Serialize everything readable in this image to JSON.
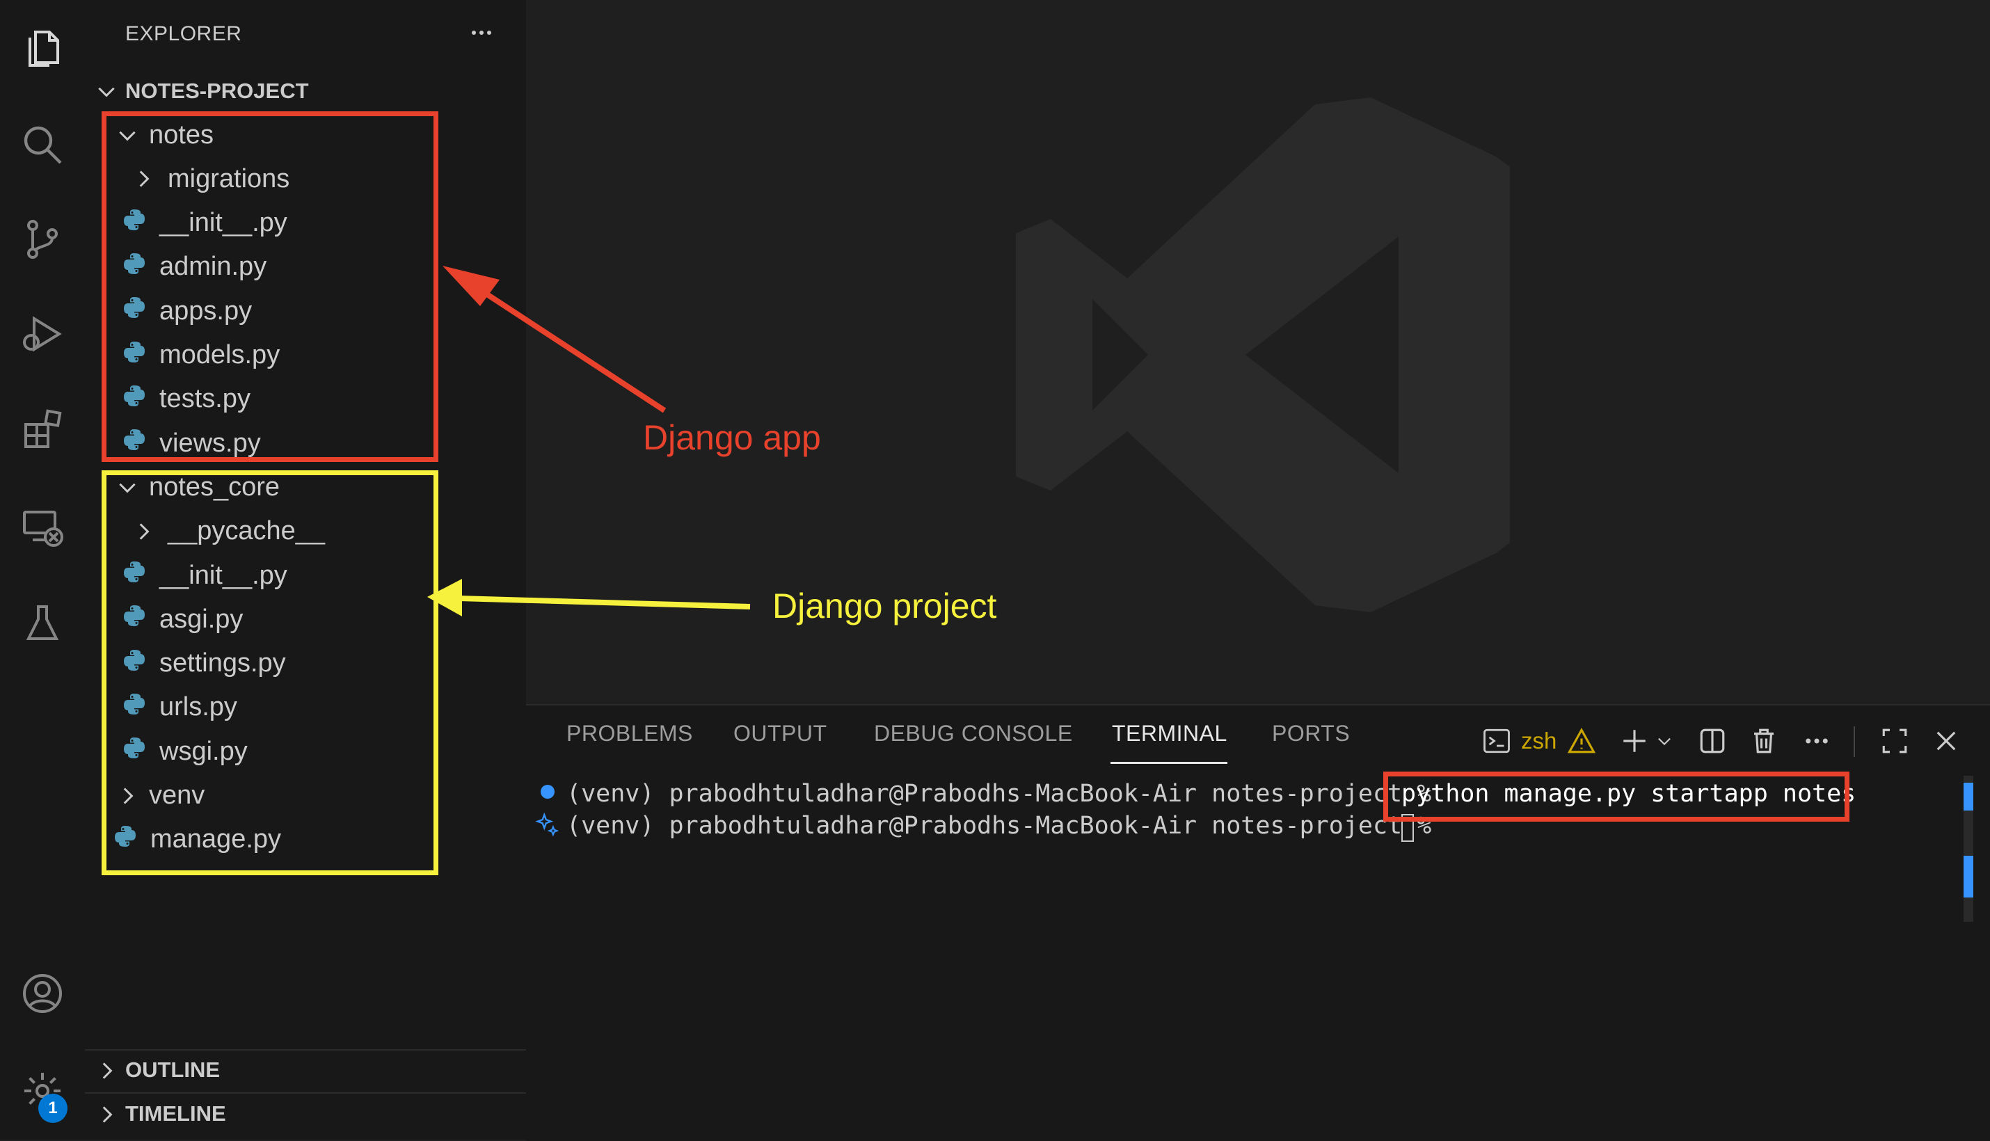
{
  "sidebar": {
    "header": "EXPLORER",
    "project": "NOTES-PROJECT",
    "folders": [
      {
        "name": "notes"
      },
      {
        "name": "notes_core"
      }
    ],
    "notes_items": [
      {
        "label": "migrations",
        "kind": "folder"
      },
      {
        "label": "__init__.py",
        "kind": "python-file"
      },
      {
        "label": "admin.py",
        "kind": "python-file"
      },
      {
        "label": "apps.py",
        "kind": "python-file"
      },
      {
        "label": "models.py",
        "kind": "python-file"
      },
      {
        "label": "tests.py",
        "kind": "python-file"
      },
      {
        "label": "views.py",
        "kind": "python-file"
      }
    ],
    "notes_core_items": [
      {
        "label": "__pycache__",
        "kind": "folder"
      },
      {
        "label": "__init__.py",
        "kind": "python-file"
      },
      {
        "label": "asgi.py",
        "kind": "python-file"
      },
      {
        "label": "settings.py",
        "kind": "python-file"
      },
      {
        "label": "urls.py",
        "kind": "python-file"
      },
      {
        "label": "wsgi.py",
        "kind": "python-file"
      }
    ],
    "venv": "venv",
    "manage": "manage.py",
    "outline": "OUTLINE",
    "timeline": "TIMELINE"
  },
  "activity_bar": {
    "icons": [
      "explorer-icon",
      "search-icon",
      "source-control-icon",
      "run-debug-icon",
      "extensions-icon",
      "remote-explorer-icon",
      "testing-icon",
      "account-icon",
      "settings-gear-icon"
    ],
    "settings_badge": "1"
  },
  "panel": {
    "tabs": [
      "PROBLEMS",
      "OUTPUT",
      "DEBUG CONSOLE",
      "TERMINAL",
      "PORTS"
    ],
    "active_tab": "TERMINAL",
    "shell": "zsh",
    "icons": [
      "terminal-icon",
      "warning-icon",
      "add-icon",
      "chevron-down-icon",
      "split-icon",
      "trash-icon",
      "more-icon",
      "maximize-icon",
      "close-icon"
    ]
  },
  "terminal": {
    "prompt": "(venv) prabodhtuladhar@Prabodhs-MacBook-Air notes-project %",
    "command": "python manage.py startapp notes",
    "prompt2": "(venv) prabodhtuladhar@Prabodhs-MacBook-Air notes-project %"
  },
  "annotations": {
    "app_label": "Django app",
    "project_label": "Django project",
    "red": "#e8412c",
    "yellow": "#f6f13c"
  },
  "colors": {
    "bg": "#1f1f1f",
    "sidebar_bg": "#181818",
    "python_icon": "#519aba",
    "accent": "#0078d4",
    "warning": "#cca700"
  }
}
